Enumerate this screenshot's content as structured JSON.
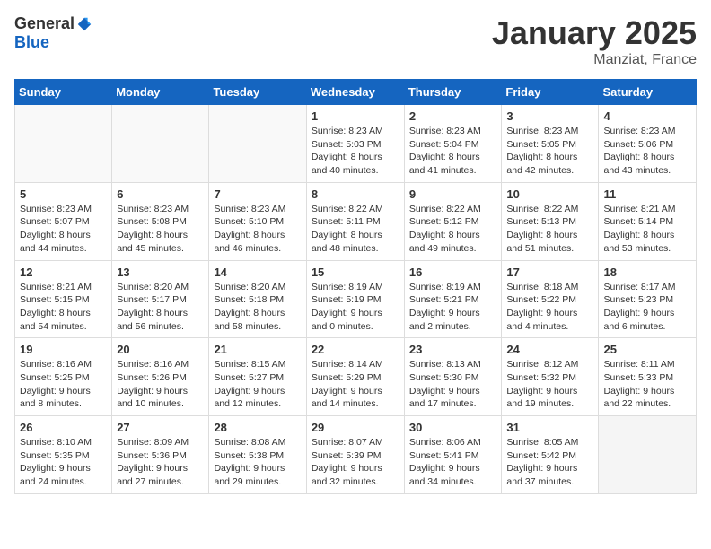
{
  "header": {
    "logo_general": "General",
    "logo_blue": "Blue",
    "month": "January 2025",
    "location": "Manziat, France"
  },
  "weekdays": [
    "Sunday",
    "Monday",
    "Tuesday",
    "Wednesday",
    "Thursday",
    "Friday",
    "Saturday"
  ],
  "weeks": [
    [
      {
        "day": "",
        "info": ""
      },
      {
        "day": "",
        "info": ""
      },
      {
        "day": "",
        "info": ""
      },
      {
        "day": "1",
        "info": "Sunrise: 8:23 AM\nSunset: 5:03 PM\nDaylight: 8 hours\nand 40 minutes."
      },
      {
        "day": "2",
        "info": "Sunrise: 8:23 AM\nSunset: 5:04 PM\nDaylight: 8 hours\nand 41 minutes."
      },
      {
        "day": "3",
        "info": "Sunrise: 8:23 AM\nSunset: 5:05 PM\nDaylight: 8 hours\nand 42 minutes."
      },
      {
        "day": "4",
        "info": "Sunrise: 8:23 AM\nSunset: 5:06 PM\nDaylight: 8 hours\nand 43 minutes."
      }
    ],
    [
      {
        "day": "5",
        "info": "Sunrise: 8:23 AM\nSunset: 5:07 PM\nDaylight: 8 hours\nand 44 minutes."
      },
      {
        "day": "6",
        "info": "Sunrise: 8:23 AM\nSunset: 5:08 PM\nDaylight: 8 hours\nand 45 minutes."
      },
      {
        "day": "7",
        "info": "Sunrise: 8:23 AM\nSunset: 5:10 PM\nDaylight: 8 hours\nand 46 minutes."
      },
      {
        "day": "8",
        "info": "Sunrise: 8:22 AM\nSunset: 5:11 PM\nDaylight: 8 hours\nand 48 minutes."
      },
      {
        "day": "9",
        "info": "Sunrise: 8:22 AM\nSunset: 5:12 PM\nDaylight: 8 hours\nand 49 minutes."
      },
      {
        "day": "10",
        "info": "Sunrise: 8:22 AM\nSunset: 5:13 PM\nDaylight: 8 hours\nand 51 minutes."
      },
      {
        "day": "11",
        "info": "Sunrise: 8:21 AM\nSunset: 5:14 PM\nDaylight: 8 hours\nand 53 minutes."
      }
    ],
    [
      {
        "day": "12",
        "info": "Sunrise: 8:21 AM\nSunset: 5:15 PM\nDaylight: 8 hours\nand 54 minutes."
      },
      {
        "day": "13",
        "info": "Sunrise: 8:20 AM\nSunset: 5:17 PM\nDaylight: 8 hours\nand 56 minutes."
      },
      {
        "day": "14",
        "info": "Sunrise: 8:20 AM\nSunset: 5:18 PM\nDaylight: 8 hours\nand 58 minutes."
      },
      {
        "day": "15",
        "info": "Sunrise: 8:19 AM\nSunset: 5:19 PM\nDaylight: 9 hours\nand 0 minutes."
      },
      {
        "day": "16",
        "info": "Sunrise: 8:19 AM\nSunset: 5:21 PM\nDaylight: 9 hours\nand 2 minutes."
      },
      {
        "day": "17",
        "info": "Sunrise: 8:18 AM\nSunset: 5:22 PM\nDaylight: 9 hours\nand 4 minutes."
      },
      {
        "day": "18",
        "info": "Sunrise: 8:17 AM\nSunset: 5:23 PM\nDaylight: 9 hours\nand 6 minutes."
      }
    ],
    [
      {
        "day": "19",
        "info": "Sunrise: 8:16 AM\nSunset: 5:25 PM\nDaylight: 9 hours\nand 8 minutes."
      },
      {
        "day": "20",
        "info": "Sunrise: 8:16 AM\nSunset: 5:26 PM\nDaylight: 9 hours\nand 10 minutes."
      },
      {
        "day": "21",
        "info": "Sunrise: 8:15 AM\nSunset: 5:27 PM\nDaylight: 9 hours\nand 12 minutes."
      },
      {
        "day": "22",
        "info": "Sunrise: 8:14 AM\nSunset: 5:29 PM\nDaylight: 9 hours\nand 14 minutes."
      },
      {
        "day": "23",
        "info": "Sunrise: 8:13 AM\nSunset: 5:30 PM\nDaylight: 9 hours\nand 17 minutes."
      },
      {
        "day": "24",
        "info": "Sunrise: 8:12 AM\nSunset: 5:32 PM\nDaylight: 9 hours\nand 19 minutes."
      },
      {
        "day": "25",
        "info": "Sunrise: 8:11 AM\nSunset: 5:33 PM\nDaylight: 9 hours\nand 22 minutes."
      }
    ],
    [
      {
        "day": "26",
        "info": "Sunrise: 8:10 AM\nSunset: 5:35 PM\nDaylight: 9 hours\nand 24 minutes."
      },
      {
        "day": "27",
        "info": "Sunrise: 8:09 AM\nSunset: 5:36 PM\nDaylight: 9 hours\nand 27 minutes."
      },
      {
        "day": "28",
        "info": "Sunrise: 8:08 AM\nSunset: 5:38 PM\nDaylight: 9 hours\nand 29 minutes."
      },
      {
        "day": "29",
        "info": "Sunrise: 8:07 AM\nSunset: 5:39 PM\nDaylight: 9 hours\nand 32 minutes."
      },
      {
        "day": "30",
        "info": "Sunrise: 8:06 AM\nSunset: 5:41 PM\nDaylight: 9 hours\nand 34 minutes."
      },
      {
        "day": "31",
        "info": "Sunrise: 8:05 AM\nSunset: 5:42 PM\nDaylight: 9 hours\nand 37 minutes."
      },
      {
        "day": "",
        "info": ""
      }
    ]
  ]
}
